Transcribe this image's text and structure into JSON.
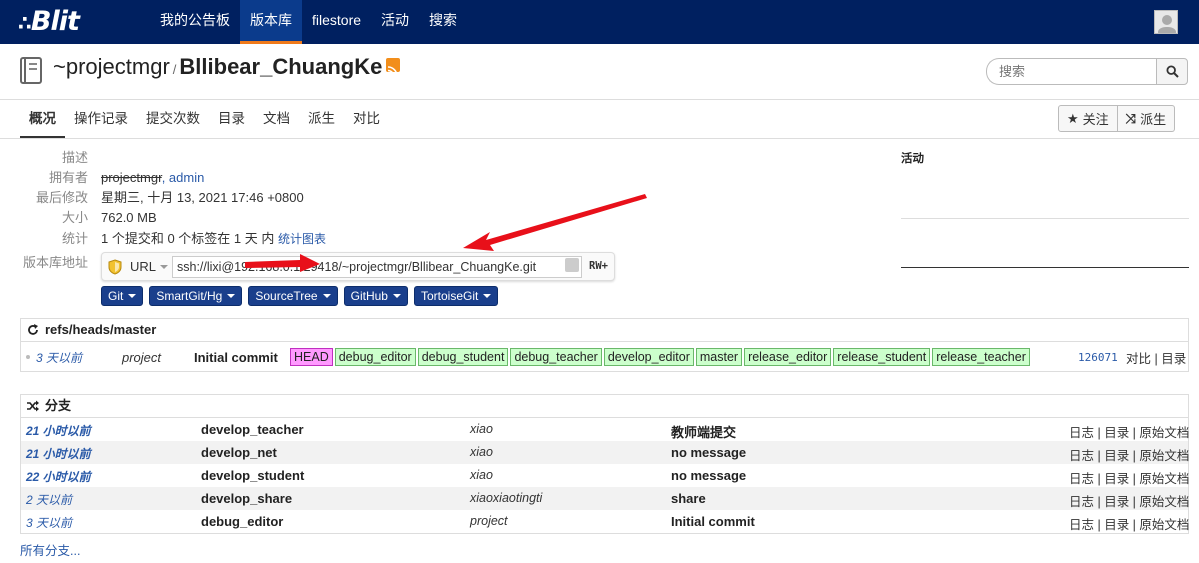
{
  "navbar": {
    "brand": "Blit",
    "items": [
      "我的公告板",
      "版本库",
      "filestore",
      "活动",
      "搜索"
    ],
    "active_index": 1
  },
  "repo": {
    "owner_path": "~projectmgr",
    "separator": "/",
    "name": "Bllibear_ChuangKe",
    "icons": [
      "repository-icon",
      "rss-icon"
    ]
  },
  "search": {
    "placeholder": "搜索",
    "icon": "search-icon"
  },
  "subnav": {
    "tabs": [
      "概况",
      "操作记录",
      "提交次数",
      "目录",
      "文档",
      "派生",
      "对比"
    ],
    "active_index": 0,
    "watch_label": "关注",
    "fork_label": "派生"
  },
  "summary": {
    "description_label": "描述",
    "owners_label": "拥有者",
    "owner_struck": "projectmgr",
    "owner_rest": ", admin",
    "last_modified_label": "最后修改",
    "last_modified": "星期三, 十月 13, 2021 17:46 +0800",
    "size_label": "大小",
    "size": "762.0 MB",
    "stats_label": "统计",
    "stats": "1 个提交和 0 个标签在 1 天 内",
    "stats_link": "统计图表",
    "url_label": "版本库地址",
    "url_protocol": "URL",
    "url": "ssh://lixi@192.168.0.1:29418/~projectmgr/Bllibear_ChuangKe.git",
    "url_permission": "RW+"
  },
  "tools": [
    "Git",
    "SmartGit/Hg",
    "SourceTree",
    "GitHub",
    "TortoiseGit"
  ],
  "activity": {
    "title": "活动"
  },
  "ref_panel": {
    "title": "refs/heads/master",
    "commit": {
      "date": "3 天以前",
      "author": "project",
      "message": "Initial commit",
      "refs": [
        "HEAD",
        "debug_editor",
        "debug_student",
        "debug_teacher",
        "develop_editor",
        "master",
        "release_editor",
        "release_student",
        "release_teacher"
      ],
      "id": "126071",
      "links": "对比 | 目录"
    }
  },
  "branches": {
    "title": "分支",
    "rows": [
      {
        "date": "21 小时以前",
        "name": "develop_teacher",
        "author": "xiao",
        "message": "教师端提交",
        "links": "日志 | 目录 | 原始文档",
        "recent": true
      },
      {
        "date": "21 小时以前",
        "name": "develop_net",
        "author": "xiao",
        "message": "no message",
        "links": "日志 | 目录 | 原始文档",
        "recent": true
      },
      {
        "date": "22 小时以前",
        "name": "develop_student",
        "author": "xiao",
        "message": "no message",
        "links": "日志 | 目录 | 原始文档",
        "recent": true
      },
      {
        "date": "2 天以前",
        "name": "develop_share",
        "author": "xiaoxiaotingti",
        "message": "share",
        "links": "日志 | 目录 | 原始文档",
        "recent": false
      },
      {
        "date": "3 天以前",
        "name": "debug_editor",
        "author": "project",
        "message": "Initial commit",
        "links": "日志 | 目录 | 原始文档",
        "recent": false
      }
    ],
    "all_link": "所有分支..."
  },
  "colors": {
    "navbar": "#002060",
    "accent": "#f07a1a",
    "link": "#2a5aa8",
    "arrow": "#e8101a"
  }
}
